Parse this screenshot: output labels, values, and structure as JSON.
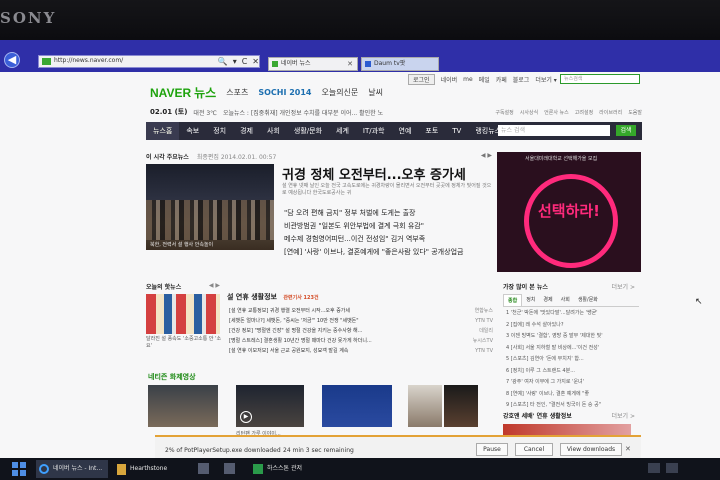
{
  "bezel": {
    "brand": "SONY"
  },
  "browser": {
    "address": "http://news.naver.com/",
    "address_controls": [
      "🔍",
      "▾",
      "C",
      "✕"
    ],
    "tabs": [
      {
        "label": "네이버 뉴스",
        "close": "✕"
      },
      {
        "label": "Daum tv팟"
      }
    ]
  },
  "page": {
    "top_links": {
      "login": "로그인",
      "items": [
        "네이버",
        "me",
        "메일",
        "카페",
        "블로그",
        "더보기 ▾"
      ]
    },
    "search_placeholder": "뉴스검색",
    "logo": {
      "naver": "NAVER",
      "news": "뉴스",
      "sub_links": [
        "스포츠",
        "SOCHI 2014",
        "오늘의신문",
        "날씨"
      ]
    },
    "infobar": {
      "date": "02.01 (토)",
      "weather": "대전 3℃",
      "ticker": "오늘뉴스 : [집중취재] 개인정보 수치를 대부분 이어... 활인한 노",
      "right_links": [
        "구독설정",
        "시사상식",
        "언론사 뉴스",
        "고려설정",
        "라이브러리",
        "도움말"
      ]
    },
    "nav": {
      "items": [
        "뉴스홈",
        "속보",
        "정치",
        "경제",
        "사회",
        "생활/문화",
        "세계",
        "IT/과학",
        "연예",
        "포토",
        "TV",
        "랭킹뉴스"
      ],
      "active_index": 0,
      "search_placeholder": "뉴스 검색",
      "search_button": "검색"
    },
    "main": {
      "section_label": "이 시각 주요뉴스",
      "timestamp": "최종편집 2014.02.01. 00:57",
      "controls": "◀ ▶",
      "photo_caption": "북한, 전력서 설 행사 안속놀이",
      "headline": "귀경 정체 오전부터...오후 증가세",
      "summary": "설 연휴 넷째 날인 오늘 전국 고속도로에는 귀경차량이 몰리면서 오전부터 곳곳에 정체가 빚어질 것으로 예상됩니다 한국도로공사는 귀",
      "sub_headlines": [
        "\"담 오려 편해 금지\" 정부 처벌에 도게는 출장",
        "비관방범권 \"일본도 위안부법에 결계 극회 유감\"",
        "메수제 경험영어피턴...이건 전성임\" 김거 역부족",
        "[연예] '사랑' 이브나, 결혼예게에 \"좋은사람 있다\" 공개상업금"
      ]
    },
    "ad": {
      "top_text": "서울대미래대학교 선택해가을 모집",
      "text": "선택하라!"
    },
    "hot": {
      "label": "오늘의 핫뉴스",
      "controls": "◀ ▶",
      "caption": "달라진 설 풍속도 '소중고소통 안 '소요'"
    },
    "topic": {
      "title": "설 연휴 생활정보",
      "tag": "관련기사 123건",
      "items": [
        {
          "text": "[설 연휴 교통정보] 귀경 행렬 오전부터 시작...오후 증가세",
          "source": "연합뉴스"
        },
        {
          "text": "[세뱃돈 얼마나?] 세뱃돈, \"중씨는 '저금'\" 10만 전쟁 \"세뱃돈\"",
          "source": "YTN TV"
        },
        {
          "text": "[건강 정보] \"명절엔 긴장\" 설 명절 건강을 지키는 중수사항 해...",
          "source": "데일리"
        },
        {
          "text": "[명절 스트레스] 결혼생활 10년간 명절 때마다 건강 못가게 하더니...",
          "source": "뉴시스TV"
        },
        {
          "text": "[설 연휴 이모저모] 서울 근교 공원묘지, 성묘객 발길 계속",
          "source": "YTN TV"
        }
      ]
    },
    "video": {
      "label": "네티즌 화제영상",
      "caption": "리턴팬 가루 이야이..."
    },
    "ranking": {
      "title": "가장 많이 본 뉴스",
      "more": "더보기 >",
      "tabs": [
        "종합",
        "정치",
        "경제",
        "사회",
        "생활/문화"
      ],
      "active_index": 0,
      "items": [
        "1 '천군' 박돈에 '맛있다말'...달려가는 '쌩굳'",
        "2 [집에] 레 수석 살아있나?",
        "3 이젠 빙벽도 '결합', 영방 중 발부 '제대한 빚'",
        "4 [사회] 서울 지하철 발 비상에...'이건 전성'",
        "5 [스포츠] 김연아 '돈에 부치지' 합...",
        "6 [정치] 이루 그 스트랜드 4분...",
        "7 '광주' 여자 이부에 그 가지로 '운녀'",
        "8 [연예] '사랑' 이브나, 결혼 예게에 \"좋",
        "9 [스포츠] 타 전인, \"결전서 빙국이 돈 승 공\""
      ]
    },
    "weather_section": {
      "title": "강호앤 세배' 연휴 생활정보",
      "more": "더보기 >"
    }
  },
  "download": {
    "name": "2% of PotPlayerSetup.exe downloaded",
    "remaining": "24 min 3 sec remaining",
    "pause": "Pause",
    "cancel": "Cancel",
    "view": "View downloads",
    "close": "✕"
  },
  "taskbar": {
    "ie_label": "네이버 뉴스 - Int...",
    "hs_label": "Hearthstone",
    "korean_label": "하스스톤 관저"
  }
}
